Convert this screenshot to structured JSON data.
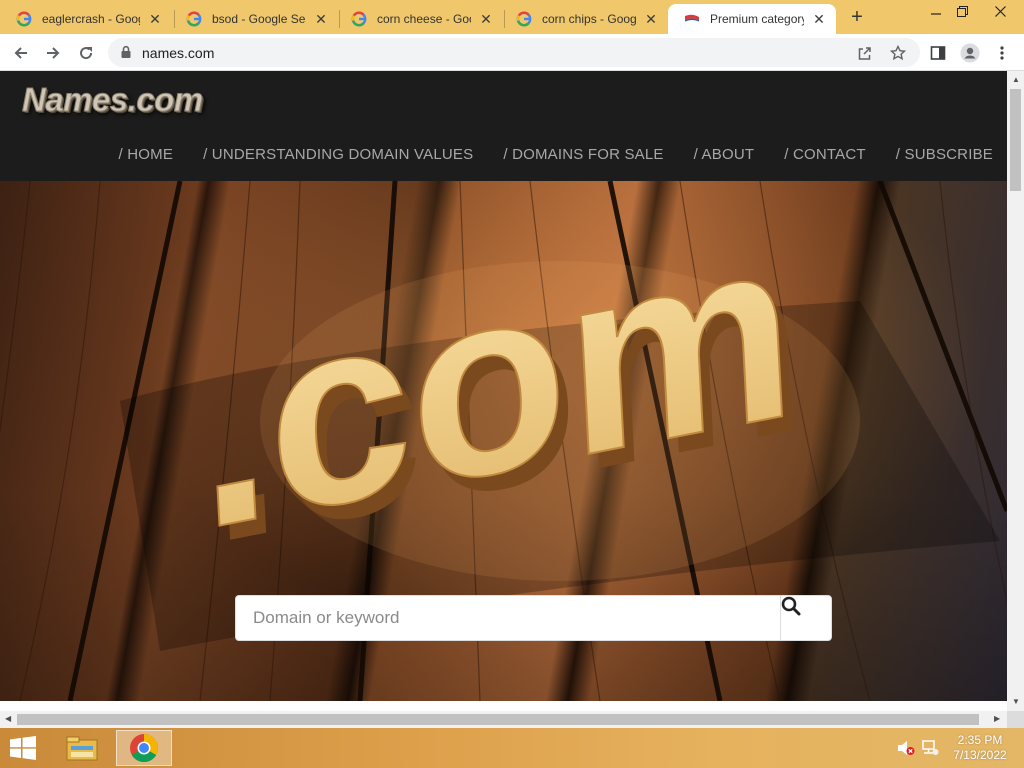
{
  "browser": {
    "tabs": [
      {
        "label": "eaglercrash - Goog",
        "favicon": "google-icon"
      },
      {
        "label": "bsod - Google Sea",
        "favicon": "google-icon"
      },
      {
        "label": "corn cheese - Goo",
        "favicon": "google-icon"
      },
      {
        "label": "corn chips - Googl",
        "favicon": "google-icon"
      },
      {
        "label": "Premium category",
        "favicon": "names-flag-icon",
        "active": true
      }
    ],
    "url": "names.com"
  },
  "site": {
    "logo": "Names.com",
    "nav": [
      "/ HOME",
      "/ UNDERSTANDING DOMAIN VALUES",
      "/ DOMAINS FOR SALE",
      "/ ABOUT",
      "/ CONTACT",
      "/ SUBSCRIBE"
    ],
    "hero_text": ".com",
    "search_placeholder": "Domain or keyword"
  },
  "taskbar": {
    "time": "2:35 PM",
    "date": "7/13/2022"
  },
  "colors": {
    "titlebar": "#f0c86b",
    "site_header": "#1c1c1c",
    "nav_text": "#a8a8a8",
    "hero_letters": "#f6d48c"
  }
}
